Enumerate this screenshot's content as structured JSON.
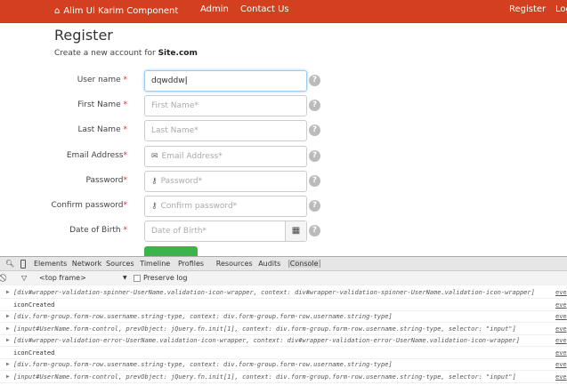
{
  "navbar": {
    "brand": "Alim Ul Karim Component",
    "links": [
      "Admin",
      "Contact Us"
    ],
    "right_links": [
      "Register",
      "Log"
    ],
    "color": "#d2401f"
  },
  "page": {
    "title": "Register",
    "subtitle_prefix": "Create a new account for ",
    "subtitle_site": "Site.com"
  },
  "form": {
    "rows": [
      {
        "label": "User name",
        "req": " *",
        "value": "dqwddw",
        "placeholder": "",
        "icon": ""
      },
      {
        "label": "First Name",
        "req": " *",
        "value": "",
        "placeholder": "First Name*",
        "icon": ""
      },
      {
        "label": "Last Name",
        "req": " *",
        "value": "",
        "placeholder": "Last Name*",
        "icon": ""
      },
      {
        "label": "Email Address",
        "req": "*",
        "value": "",
        "placeholder": "Email Address*",
        "icon": "envelope-icon"
      },
      {
        "label": "Password",
        "req": "*",
        "value": "",
        "placeholder": "Password*",
        "icon": "key-icon"
      },
      {
        "label": "Confirm password",
        "req": "*",
        "value": "",
        "placeholder": "Confirm password*",
        "icon": "key-icon"
      },
      {
        "label": "Date of Birth",
        "req": " *",
        "value": "",
        "placeholder": "Date of Birth*",
        "icon": "calendar-icon"
      }
    ],
    "help_glyph": "?"
  },
  "devtools": {
    "tabs": [
      "Elements",
      "Network",
      "Sources",
      "Timeline",
      "Profiles",
      "Resources",
      "Audits",
      "Console"
    ],
    "active_tab": "Console",
    "frame": "<top frame>",
    "preserve_log": "Preserve log",
    "lines": [
      {
        "text": "[div#wrapper-validation-spinner-UserName.validation-icon-wrapper, context: div#wrapper-validation-spinner-UserName.validation-icon-wrapper]",
        "obj": true,
        "src": "eve"
      },
      {
        "text": "iconCreated",
        "obj": false,
        "src": "eve"
      },
      {
        "text": "[div.form-group.form-row.username.string-type, context: div.form-group.form-row.username.string-type]",
        "obj": true,
        "src": "eve"
      },
      {
        "text": "[input#UserName.form-control, prevObject: jQuery.fn.init[1], context: div.form-group.form-row.username.string-type, selector: \"input\"]",
        "obj": true,
        "src": "eve"
      },
      {
        "text": "[div#wrapper-validation-error-UserName.validation-icon-wrapper, context: div#wrapper-validation-error-UserName.validation-icon-wrapper]",
        "obj": true,
        "src": "eve"
      },
      {
        "text": "iconCreated",
        "obj": false,
        "src": "eve"
      },
      {
        "text": "[div.form-group.form-row.username.string-type, context: div.form-group.form-row.username.string-type]",
        "obj": true,
        "src": "eve"
      },
      {
        "text": "[input#UserName.form-control, prevObject: jQuery.fn.init[1], context: div.form-group.form-row.username.string-type, selector: \"input\"]",
        "obj": true,
        "src": "eve"
      }
    ]
  }
}
